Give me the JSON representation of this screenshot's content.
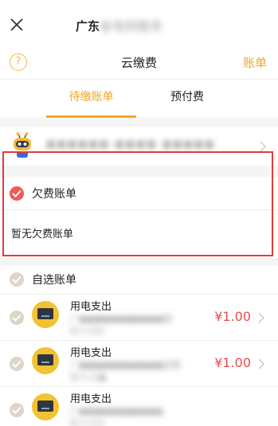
{
  "topbar": {
    "title": "广东",
    "title_masked": "省电网服务"
  },
  "header": {
    "help_symbol": "?",
    "title": "云缴费",
    "bill_link": "账单"
  },
  "tabs": [
    {
      "label": "待缴账单",
      "active": true
    },
    {
      "label": "预付费",
      "active": false
    }
  ],
  "account": {
    "masked_text": "●●●●●● ●●●● ●●●●●"
  },
  "arrears": {
    "label": "欠费账单",
    "empty_text": "暂无欠费账单"
  },
  "optional": {
    "label": "自选账单",
    "items": [
      {
        "type": "用电支出",
        "line2_masked": "广●●●●●●●●●●●楼",
        "line3_masked": "层-9-409",
        "amount": "¥1.00",
        "icon": "electric-bill-icon"
      },
      {
        "type": "用电支出",
        "line2_masked": "广●●●●●●●●●●●驭楼",
        "line3_masked": "层-9-20●",
        "amount": "¥1.00",
        "icon": "electric-bill-icon"
      },
      {
        "type": "用电支出",
        "line2_masked": "广●●●●●●●●●●●",
        "line3_masked": "层-9-409",
        "amount": "",
        "icon": "electric-bill-icon"
      }
    ]
  },
  "colors": {
    "accent": "#f5a623",
    "danger": "#e23b3b",
    "check_red": "#ef5a5a",
    "check_grey": "#ddd6c8",
    "amount": "#e84c4c"
  }
}
